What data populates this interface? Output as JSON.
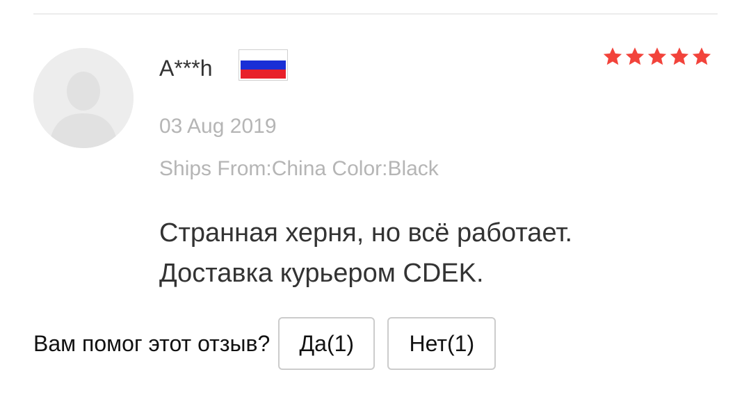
{
  "review": {
    "username": "A***h",
    "country_flag": "russia-flag-icon",
    "rating": 5,
    "date": "03 Aug 2019",
    "attributes": "Ships From:China Color:Black",
    "text_lines": [
      "Странная херня, но всё работает.",
      "Доставка курьером CDEK."
    ]
  },
  "helpful": {
    "question": "Вам помог этот отзыв?",
    "yes_label": "Да(1)",
    "no_label": "Нет(1)"
  },
  "colors": {
    "star": "#f2433b",
    "muted_text": "#b5b5b5",
    "main_text": "#333333",
    "avatar_bg": "#ededed"
  }
}
